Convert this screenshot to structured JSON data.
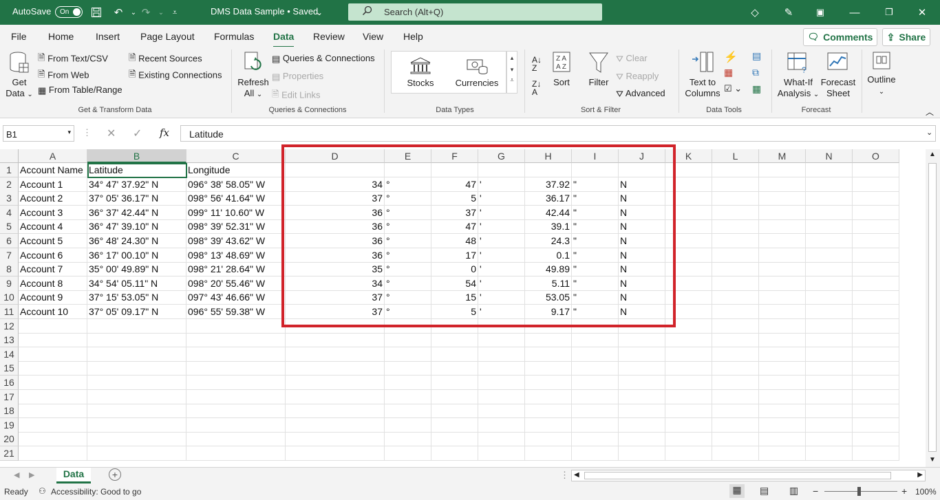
{
  "titlebar": {
    "autosave_label": "AutoSave",
    "autosave_state": "On",
    "document_title": "DMS Data Sample • Saved",
    "search_placeholder": "Search (Alt+Q)"
  },
  "tabs": [
    "File",
    "Home",
    "Insert",
    "Page Layout",
    "Formulas",
    "Data",
    "Review",
    "View",
    "Help"
  ],
  "active_tab": "Data",
  "header_buttons": {
    "comments": "Comments",
    "share": "Share"
  },
  "ribbon": {
    "get_data": "Get Data",
    "get_data_line1": "Get",
    "get_data_line2": "Data",
    "from_text_csv": "From Text/CSV",
    "from_web": "From Web",
    "from_table_range": "From Table/Range",
    "recent_sources": "Recent Sources",
    "existing_connections": "Existing Connections",
    "group_get_transform": "Get & Transform Data",
    "refresh_line1": "Refresh",
    "refresh_line2": "All",
    "queries_connections": "Queries & Connections",
    "properties": "Properties",
    "edit_links": "Edit Links",
    "group_queries": "Queries & Connections",
    "stocks": "Stocks",
    "currencies": "Currencies",
    "group_data_types": "Data Types",
    "sort": "Sort",
    "filter": "Filter",
    "clear": "Clear",
    "reapply": "Reapply",
    "advanced": "Advanced",
    "group_sort_filter": "Sort & Filter",
    "text_to_columns_line1": "Text to",
    "text_to_columns_line2": "Columns",
    "group_data_tools": "Data Tools",
    "what_if_line1": "What-If",
    "what_if_line2": "Analysis",
    "forecast_line1": "Forecast",
    "forecast_line2": "Sheet",
    "group_forecast": "Forecast",
    "outline": "Outline"
  },
  "formula_bar": {
    "name_box": "B1",
    "fx": "fx",
    "content": "Latitude"
  },
  "columns": [
    "A",
    "B",
    "C",
    "D",
    "E",
    "F",
    "G",
    "H",
    "I",
    "J",
    "K",
    "L",
    "M",
    "N",
    "O"
  ],
  "rows": [
    [
      "Account Name",
      "Latitude",
      "Longitude",
      "",
      "",
      "",
      "",
      "",
      "",
      ""
    ],
    [
      "Account 1",
      "34° 47' 37.92\" N",
      "096° 38' 58.05\" W",
      "34",
      "°",
      "47",
      "'",
      "37.92",
      "\"",
      "N"
    ],
    [
      "Account 2",
      "37° 05' 36.17\" N",
      "098° 56' 41.64\" W",
      "37",
      "°",
      "5",
      "'",
      "36.17",
      "\"",
      "N"
    ],
    [
      "Account 3",
      "36° 37' 42.44\" N",
      "099° 11' 10.60\" W",
      "36",
      "°",
      "37",
      "'",
      "42.44",
      "\"",
      "N"
    ],
    [
      "Account 4",
      "36° 47' 39.10\" N",
      "098° 39' 52.31\" W",
      "36",
      "°",
      "47",
      "'",
      "39.1",
      "\"",
      "N"
    ],
    [
      "Account 5",
      "36° 48' 24.30\" N",
      "098° 39' 43.62\" W",
      "36",
      "°",
      "48",
      "'",
      "24.3",
      "\"",
      "N"
    ],
    [
      "Account 6",
      "36° 17' 00.10\" N",
      "098° 13' 48.69\" W",
      "36",
      "°",
      "17",
      "'",
      "0.1",
      "\"",
      "N"
    ],
    [
      "Account 7",
      "35° 00' 49.89\" N",
      "098° 21' 28.64\" W",
      "35",
      "°",
      "0",
      "'",
      "49.89",
      "\"",
      "N"
    ],
    [
      "Account 8",
      "34° 54' 05.11\" N",
      "098° 20' 55.46\" W",
      "34",
      "°",
      "54",
      "'",
      "5.11",
      "\"",
      "N"
    ],
    [
      "Account 9",
      "37° 15' 53.05\" N",
      "097° 43' 46.66\" W",
      "37",
      "°",
      "15",
      "'",
      "53.05",
      "\"",
      "N"
    ],
    [
      "Account 10",
      "37° 05' 09.17\" N",
      "096° 55' 59.38\" W",
      "37",
      "°",
      "5",
      "'",
      "9.17",
      "\"",
      "N"
    ]
  ],
  "row_numbers": [
    "1",
    "2",
    "3",
    "4",
    "5",
    "6",
    "7",
    "8",
    "9",
    "10",
    "11",
    "12",
    "13",
    "14",
    "15",
    "16",
    "17",
    "18",
    "19",
    "20",
    "21"
  ],
  "sheet_tab": "Data",
  "status": {
    "ready": "Ready",
    "accessibility": "Accessibility: Good to go",
    "zoom": "100%"
  }
}
